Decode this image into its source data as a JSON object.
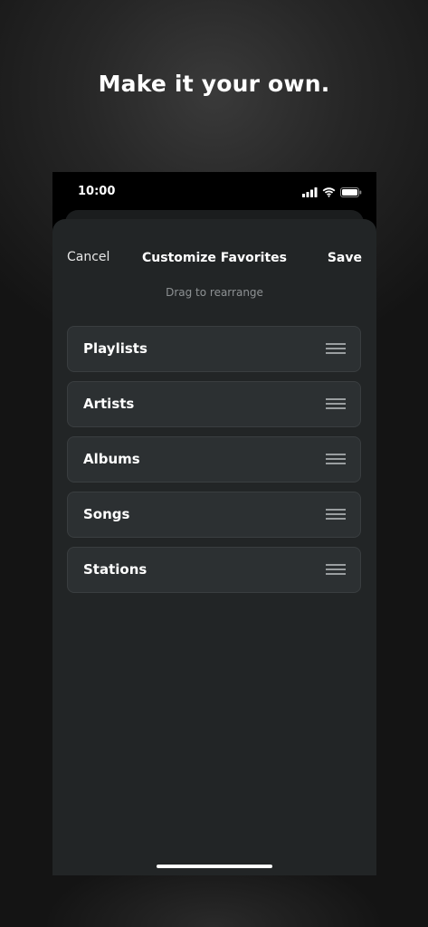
{
  "headline": "Make it your own.",
  "status_bar": {
    "time": "10:00",
    "icons": [
      "signal-icon",
      "wifi-icon",
      "battery-icon"
    ]
  },
  "nav": {
    "cancel_label": "Cancel",
    "title": "Customize Favorites",
    "save_label": "Save"
  },
  "hint": "Drag to rearrange",
  "items": [
    {
      "label": "Playlists"
    },
    {
      "label": "Artists"
    },
    {
      "label": "Albums"
    },
    {
      "label": "Songs"
    },
    {
      "label": "Stations"
    }
  ],
  "colors": {
    "sheet_background": "#222526",
    "item_background": "#2c3032",
    "hint_text": "#8d9193"
  }
}
